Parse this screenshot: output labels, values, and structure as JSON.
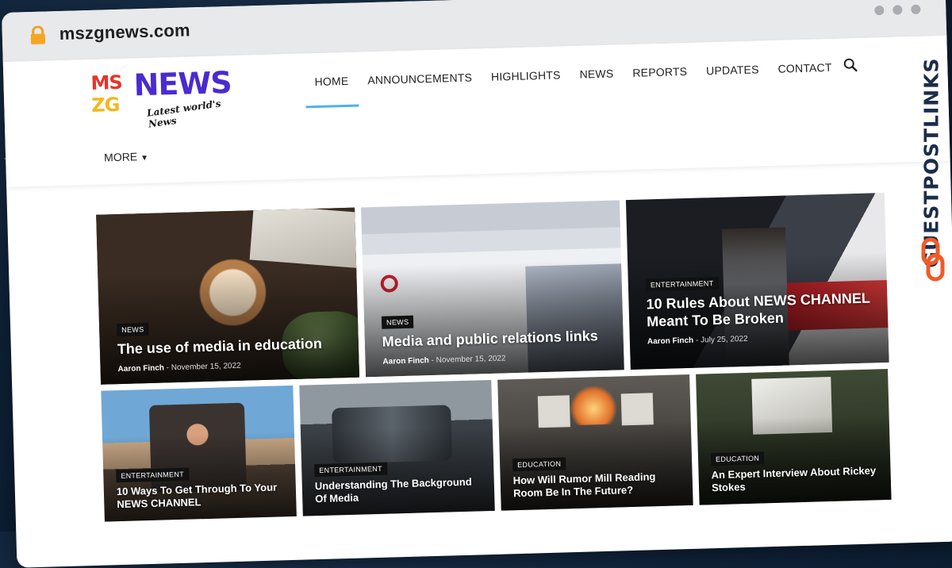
{
  "browser": {
    "url": "mszgnews.com"
  },
  "logo": {
    "ms": "MS",
    "zg": "ZG",
    "news": "NEWS",
    "tagline": "Latest world's News"
  },
  "nav": {
    "items": [
      {
        "label": "HOME",
        "active": true
      },
      {
        "label": "ANNOUNCEMENTS"
      },
      {
        "label": "HIGHLIGHTS"
      },
      {
        "label": "NEWS"
      },
      {
        "label": "REPORTS"
      },
      {
        "label": "UPDATES"
      },
      {
        "label": "CONTACT"
      }
    ],
    "more_label": "MORE",
    "search_icon": "search-icon"
  },
  "featured": [
    {
      "category": "NEWS",
      "title": "The use of media in education",
      "author": "Aaron Finch",
      "date": "November 15, 2022"
    },
    {
      "category": "NEWS",
      "title": "Media and public relations links",
      "author": "Aaron Finch",
      "date": "November 15, 2022"
    },
    {
      "category": "ENTERTAINMENT",
      "title": "10 Rules About NEWS CHANNEL Meant To Be Broken",
      "author": "Aaron Finch",
      "date": "July 25, 2022"
    }
  ],
  "secondary": [
    {
      "category": "ENTERTAINMENT",
      "title": "10 Ways To Get Through To Your NEWS CHANNEL"
    },
    {
      "category": "ENTERTAINMENT",
      "title": "Understanding The Background Of Media"
    },
    {
      "category": "EDUCATION",
      "title": "How Will Rumor Mill Reading Room Be In The Future?"
    },
    {
      "category": "EDUCATION",
      "title": "An Expert Interview About Rickey Stokes"
    }
  ],
  "watermark": {
    "text": "GUESTPOSTLINKS"
  },
  "colors": {
    "accent": "#4db2ec",
    "logo_news": "#4a2bd0"
  }
}
